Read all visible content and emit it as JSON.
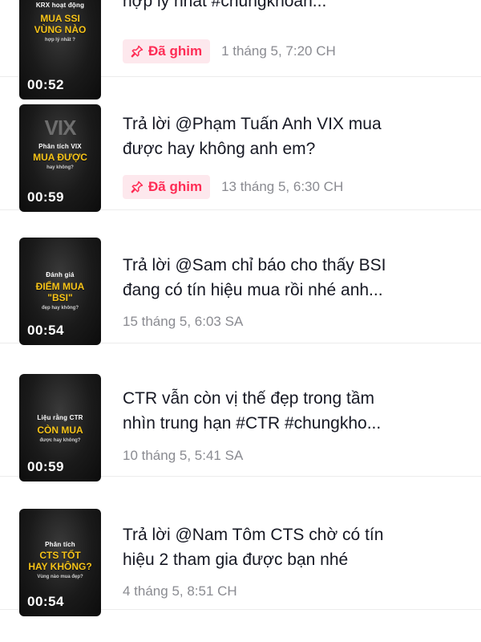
{
  "videos": [
    {
      "thumb": {
        "top": "KRX hoạt động",
        "big1": "MUA SSI",
        "big2": "VÙNG NÀO",
        "sub": "hợp lý nhất ?",
        "duration": "00:52"
      },
      "title": "hợp lý nhất #chungkhoan...",
      "pinned": true,
      "pin_label": "Đã ghim",
      "date": "1 tháng 5, 7:20 CH"
    },
    {
      "thumb": {
        "logo": "VIX",
        "top": "Phân tích VIX",
        "big1": "MUA ĐƯỢC",
        "sub": "hay không?",
        "duration": "00:59"
      },
      "title": "Trả lời @Phạm Tuấn Anh VIX mua\nđược hay không anh em?",
      "pinned": true,
      "pin_label": "Đã ghim",
      "date": "13 tháng 5, 6:30 CH"
    },
    {
      "thumb": {
        "top": "Đánh giá",
        "big1": "ĐIỂM MUA",
        "big2": "\"BSI\"",
        "sub": "đẹp hay không?",
        "duration": "00:54"
      },
      "title": "Trả lời @Sam chỉ báo cho thấy BSI\nđang có tín hiệu mua rồi nhé anh...",
      "pinned": false,
      "date": "15 tháng 5, 6:03 SA"
    },
    {
      "thumb": {
        "top": "Liệu rằng CTR",
        "big1": "CÒN MUA",
        "sub": "được hay không?",
        "duration": "00:59"
      },
      "title": "CTR vẫn còn vị thế đẹp trong tầm\nnhìn trung hạn #CTR #chungkho...",
      "pinned": false,
      "date": "10 tháng 5, 5:41 SA"
    },
    {
      "thumb": {
        "top": "Phân tích",
        "big1": "CTS TỐT",
        "big2": "HAY KHÔNG?",
        "sub": "Vùng nào mua đẹp?",
        "duration": "00:54"
      },
      "title": "Trả lời @Nam Tôm CTS chờ có tín\nhiệu 2 tham gia được bạn nhé",
      "pinned": false,
      "date": "4 tháng 5, 8:51 CH"
    }
  ],
  "colors": {
    "pin_text": "#fe2c55",
    "pin_bg": "#fde8ed",
    "date": "#8a8b91",
    "thumb_accent": "#f6c318"
  },
  "icons": {
    "pin": "pin-icon"
  }
}
